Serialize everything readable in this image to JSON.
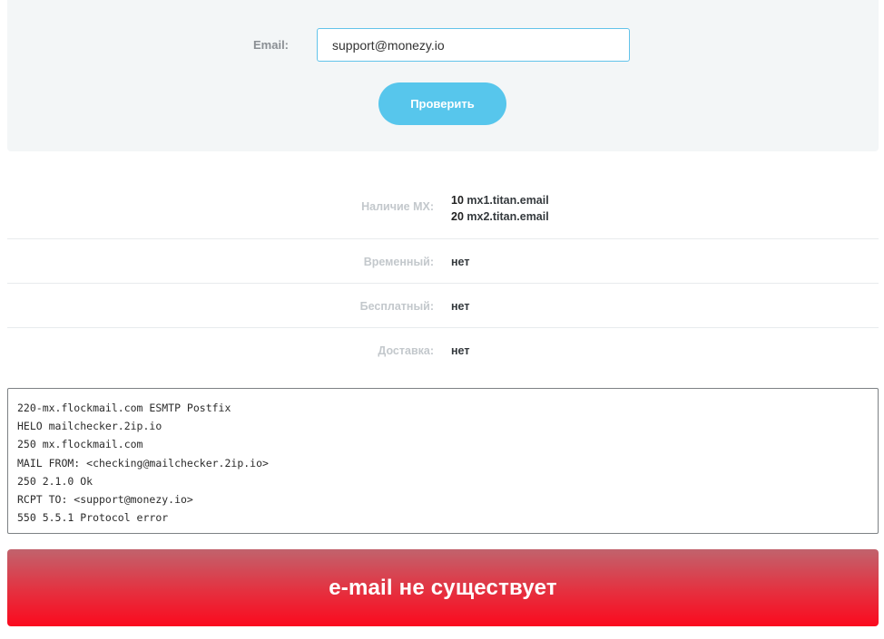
{
  "form": {
    "email_label": "Email:",
    "email_value": "support@monezy.io",
    "check_button": "Проверить"
  },
  "results": {
    "mx": {
      "label": "Наличие MX:",
      "records": [
        {
          "priority": "10",
          "host": "mx1.titan.email"
        },
        {
          "priority": "20",
          "host": "mx2.titan.email"
        }
      ]
    },
    "temporary": {
      "label": "Временный:",
      "value": "нет"
    },
    "free": {
      "label": "Бесплатный:",
      "value": "нет"
    },
    "delivery": {
      "label": "Доставка:",
      "value": "нет"
    }
  },
  "log": {
    "lines": [
      "220-mx.flockmail.com ESMTP Postfix",
      "HELO mailchecker.2ip.io",
      "250 mx.flockmail.com",
      "MAIL FROM: <checking@mailchecker.2ip.io>",
      "250 2.1.0 Ok",
      "RCPT TO: <support@monezy.io>",
      "550 5.5.1 Protocol error"
    ]
  },
  "result": {
    "text": "e-mail не существует"
  },
  "colors": {
    "accent": "#57c6ec",
    "error": "#fb0a1e",
    "panel": "#f3f6f7"
  }
}
